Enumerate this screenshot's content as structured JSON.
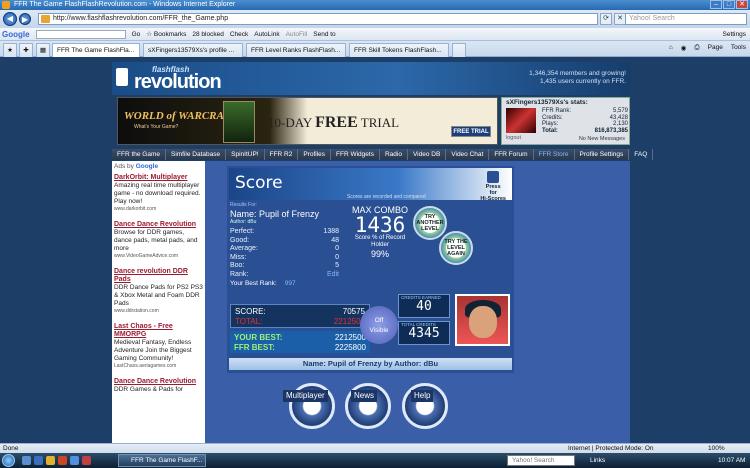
{
  "window": {
    "title": "FFR The Game FlashFlashRevolution.com - Windows Internet Explorer"
  },
  "address": {
    "url": "http://www.flashflashrevolution.com/FFR_the_Game.php",
    "search_placeholder": "Yahoo! Search"
  },
  "toolbar": {
    "google": "Google",
    "go": "Go",
    "bookmarks": "Bookmarks",
    "blocked": "28 blocked",
    "check": "Check",
    "autolink": "AutoLink",
    "autofill": "AutoFill",
    "sendto": "Send to",
    "settings": "Settings"
  },
  "tabs": [
    {
      "label": "FFR The Game FlashFla..."
    },
    {
      "label": "sXFingers13579Xs's profile ..."
    },
    {
      "label": "FFR Level Ranks FlashFlash..."
    },
    {
      "label": "FFR Skill Tokens FlashFlash..."
    }
  ],
  "tab_tools": {
    "page": "Page",
    "tools": "Tools"
  },
  "site": {
    "logo_small": "flashflash",
    "logo_big": "revolution",
    "members_line1": "1,346,354 members and growing!",
    "members_line2": "1,435 users currently on FFR."
  },
  "ad": {
    "game": "WORLD of WARCRAFT",
    "tagline": "What's Your Game?",
    "offer_pre": "10-DAY ",
    "offer_free": "FREE",
    "offer_post": " TRIAL",
    "button": "FREE TRIAL"
  },
  "stats": {
    "title": "sXFingers13579Xs's stats:",
    "rows": [
      {
        "label": "FFR Rank:",
        "value": "5,579"
      },
      {
        "label": "Credits:",
        "value": "43,428"
      },
      {
        "label": "Plays:",
        "value": "2,130"
      },
      {
        "label": "Total:",
        "value": "816,873,385"
      }
    ],
    "logout": "logout",
    "messages": "No New Messages"
  },
  "nav": [
    "FFR the Game",
    "Simfile Database",
    "SpinItUP!",
    "FFR R2",
    "Profiles",
    "FFR Widgets",
    "Radio",
    "Video DB",
    "Video Chat",
    "FFR Forum",
    "FFR Store",
    "Profile Settings",
    "FAQ"
  ],
  "sidebar": {
    "ads_by": "Ads by ",
    "google": "Google",
    "ads": [
      {
        "title": "DarkOrbit: Multiplayer",
        "desc": "Amazing real time multiplayer game - no download required. Play now!",
        "url": "www.darkorbit.com"
      },
      {
        "title": "Dance Dance Revolution",
        "desc": "Browse for DDR games, dance pads, metal pads, and more",
        "url": "www.VideoGameAdvice.com"
      },
      {
        "title": "Dance revolution DDR Pads",
        "desc": "DDR Dance Pads for PS2 PS3 & Xbox Metal and Foam DDR Pads",
        "url": "www.ddrstation.com"
      },
      {
        "title": "Last Chaos - Free MMORPG",
        "desc": "Medieval Fantasy, Endless Adventure Join the Biggest Gaming Community!",
        "url": "LastChaos.aeriagames.com"
      },
      {
        "title": "Dance Dance Revolution",
        "desc": "DDR Games & Pads for",
        "url": ""
      }
    ]
  },
  "game": {
    "heading": "Score",
    "press_line1": "Press",
    "press_line2": "for",
    "press_line3": "Hi-Scores",
    "recorded": "Scores are recorded and compared",
    "results_for": "Results For:",
    "song_line": "Name: Pupil of Frenzy",
    "author_line": "Author: dBu",
    "judgements": [
      {
        "label": "Perfect:",
        "value": "1388"
      },
      {
        "label": "Good:",
        "value": "48"
      },
      {
        "label": "Average:",
        "value": "0"
      },
      {
        "label": "Miss:",
        "value": "0"
      },
      {
        "label": "Boo:",
        "value": "5"
      },
      {
        "label": "Rank:",
        "value": "Edit"
      }
    ],
    "best_rank_label": "Your Best Rank:",
    "best_rank_value": "997",
    "max_combo_label": "MAX COMBO",
    "max_combo": "1436",
    "score_pct_label": "Score % of Record Holder",
    "score_pct": "99%",
    "try_another": "TRY ANOTHER LEVEL",
    "try_again": "TRY THE LEVEL AGAIN",
    "score_label": "SCORE:",
    "score_value": "70575",
    "total_label": "TOTAL:",
    "total_value": "2212500",
    "your_best_label": "YOUR BEST:",
    "your_best_value": "2212500",
    "ffr_best_label": "FFR BEST:",
    "ffr_best_value": "2225800",
    "off_line1": "Off",
    "off_line2": "Visible",
    "credits_earned_label": "CREDITS EARNED",
    "credits_earned": "40",
    "total_credits_label": "TOTAL CREDITS",
    "total_credits": "4345",
    "footer": "Name: Pupil of Frenzy by Author: dBu",
    "buttons": [
      {
        "label": "Multiplayer"
      },
      {
        "label": "News"
      },
      {
        "label": "Help"
      }
    ]
  },
  "status": {
    "left": "Done",
    "zone": "Internet | Protected Mode: On",
    "zoom": "100%"
  },
  "taskbar": {
    "task": "FFR The Game FlashF...",
    "search": "Yahoo! Search",
    "links": "Links",
    "clock": "10:07 AM"
  }
}
